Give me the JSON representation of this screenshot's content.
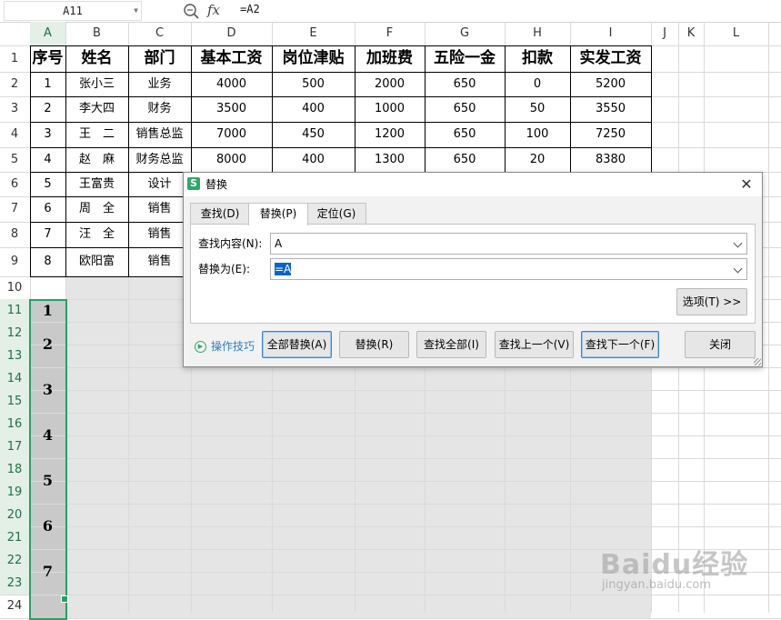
{
  "formula_bar": {
    "name_box": "A11",
    "function_symbol": "fx",
    "formula": "=A2"
  },
  "columns": [
    "A",
    "B",
    "C",
    "D",
    "E",
    "F",
    "G",
    "H",
    "I",
    "J",
    "K",
    "L"
  ],
  "rows": [
    "1",
    "2",
    "3",
    "4",
    "5",
    "6",
    "7",
    "8",
    "9",
    "10",
    "11",
    "12",
    "13",
    "14",
    "15",
    "16",
    "17",
    "18",
    "19",
    "20",
    "21",
    "22",
    "23",
    "24"
  ],
  "table": {
    "headers": [
      "序号",
      "姓名",
      "部门",
      "基本工资",
      "岗位津贴",
      "加班费",
      "五险一金",
      "扣款",
      "实发工资"
    ],
    "rows": [
      [
        "1",
        "张小三",
        "业务",
        "4000",
        "500",
        "2000",
        "650",
        "0",
        "5200"
      ],
      [
        "2",
        "李大四",
        "财务",
        "3500",
        "400",
        "1000",
        "650",
        "50",
        "3550"
      ],
      [
        "3",
        "王　二",
        "销售总监",
        "7000",
        "450",
        "1200",
        "650",
        "100",
        "7250"
      ],
      [
        "4",
        "赵　麻",
        "财务总监",
        "8000",
        "400",
        "1300",
        "650",
        "20",
        "8380"
      ],
      [
        "5",
        "王富贵",
        "设计"
      ],
      [
        "6",
        "周　全",
        "销售"
      ],
      [
        "7",
        "汪　全",
        "销售"
      ],
      [
        "8",
        "欧阳富",
        "销售"
      ]
    ]
  },
  "selection_numbers": [
    "1",
    "2",
    "3",
    "4",
    "5",
    "6",
    "7"
  ],
  "dialog": {
    "title": "替换",
    "app_icon": "S",
    "close_symbol": "✕",
    "tabs": [
      "查找(D)",
      "替换(P)",
      "定位(G)"
    ],
    "active_tab": "替换(P)",
    "find_label": "查找内容(N):",
    "find_value": "A",
    "replace_label": "替换为(E):",
    "replace_value": "=A",
    "options_button": "选项(T) >>",
    "tips_label": "操作技巧",
    "buttons": [
      "全部替换(A)",
      "替换(R)",
      "查找全部(I)",
      "查找上一个(V)",
      "查找下一个(F)",
      "关闭"
    ]
  },
  "watermark": {
    "text": "Baidu经验",
    "sub": "jingyan.baidu.com"
  },
  "colors": {
    "selection": "#21a366",
    "highlight": "#0a64c8"
  }
}
